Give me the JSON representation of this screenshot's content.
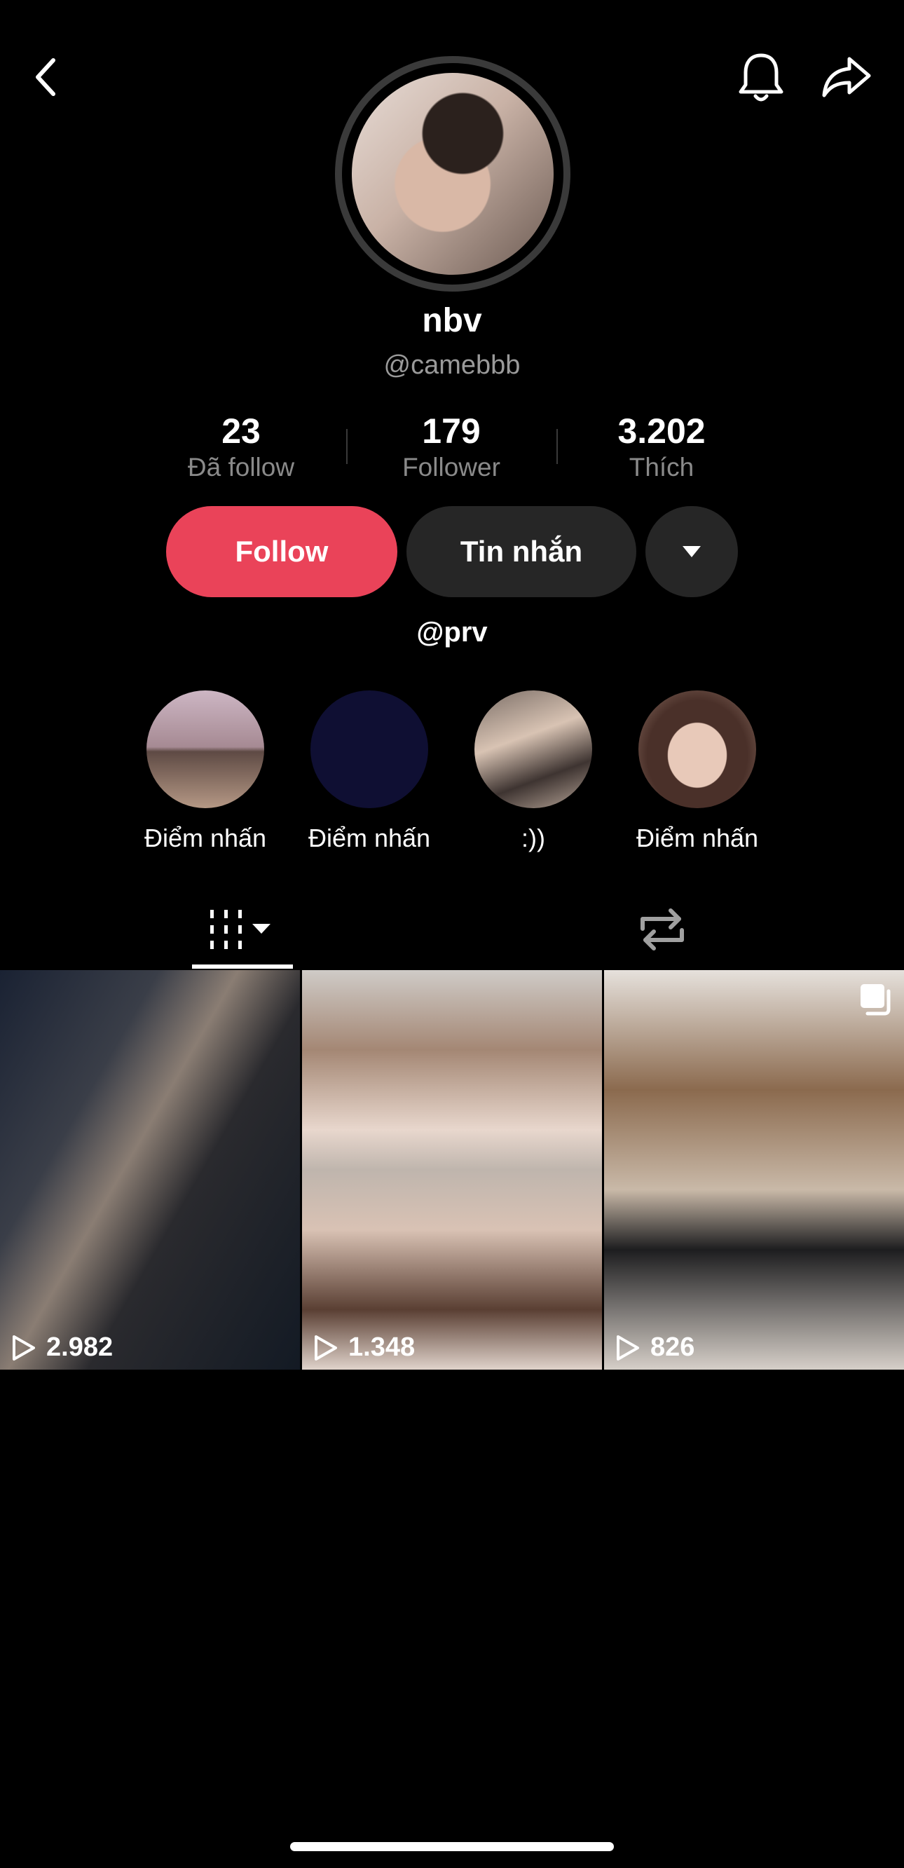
{
  "profile": {
    "name": "nbv",
    "handle": "@camebbb",
    "bio": "@prv"
  },
  "stats": [
    {
      "value": "23",
      "label": "Đã follow"
    },
    {
      "value": "179",
      "label": "Follower"
    },
    {
      "value": "3.202",
      "label": "Thích"
    }
  ],
  "actions": {
    "follow_label": "Follow",
    "message_label": "Tin nhắn"
  },
  "highlights": [
    {
      "label": "Điểm nhấn"
    },
    {
      "label": "Điểm nhấn"
    },
    {
      "label": ":))"
    },
    {
      "label": "Điểm nhấn"
    }
  ],
  "videos": [
    {
      "views": "2.982"
    },
    {
      "views": "1.348"
    },
    {
      "views": "826"
    }
  ],
  "colors": {
    "accent": "#ea4359",
    "button_dark": "#262626",
    "background": "#000000"
  },
  "icons": [
    "back-icon",
    "bell-icon",
    "share-icon",
    "chevron-down-icon",
    "grid-icon",
    "repost-icon",
    "play-icon",
    "multi-photo-icon"
  ]
}
